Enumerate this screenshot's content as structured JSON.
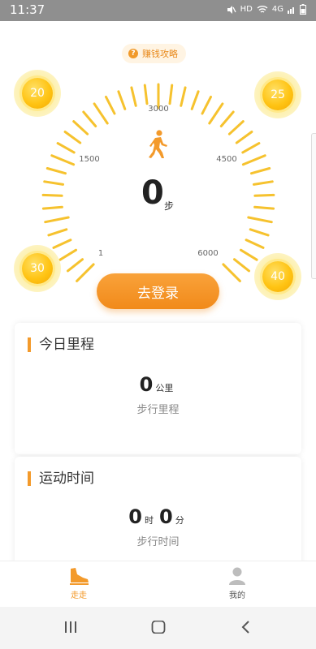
{
  "status_bar": {
    "time": "11:37",
    "network": "HD",
    "signal_type": "4G"
  },
  "tips": {
    "label": "赚钱攻略",
    "icon": "question-icon"
  },
  "coins": [
    {
      "value": "20"
    },
    {
      "value": "25"
    },
    {
      "value": "30"
    },
    {
      "value": "40"
    }
  ],
  "gauge": {
    "labels": {
      "min": "1",
      "low": "1500",
      "mid": "3000",
      "high": "4500",
      "max": "6000"
    },
    "steps": "0",
    "steps_unit": "步",
    "icon": "walker-icon"
  },
  "login_button": "去登录",
  "cards": {
    "mileage": {
      "title": "今日里程",
      "value": "0",
      "unit": "公里",
      "subtitle": "步行里程"
    },
    "time": {
      "title": "运动时间",
      "hours": "0",
      "hours_unit": "时",
      "minutes": "0",
      "minutes_unit": "分",
      "subtitle": "步行时间"
    }
  },
  "tabs": [
    {
      "label": "走走",
      "icon": "shoe-icon",
      "active": true
    },
    {
      "label": "我的",
      "icon": "user-icon",
      "active": false
    }
  ],
  "colors": {
    "accent": "#f39a2b",
    "coin": "#ffc414",
    "tick": "#f6c22e"
  }
}
